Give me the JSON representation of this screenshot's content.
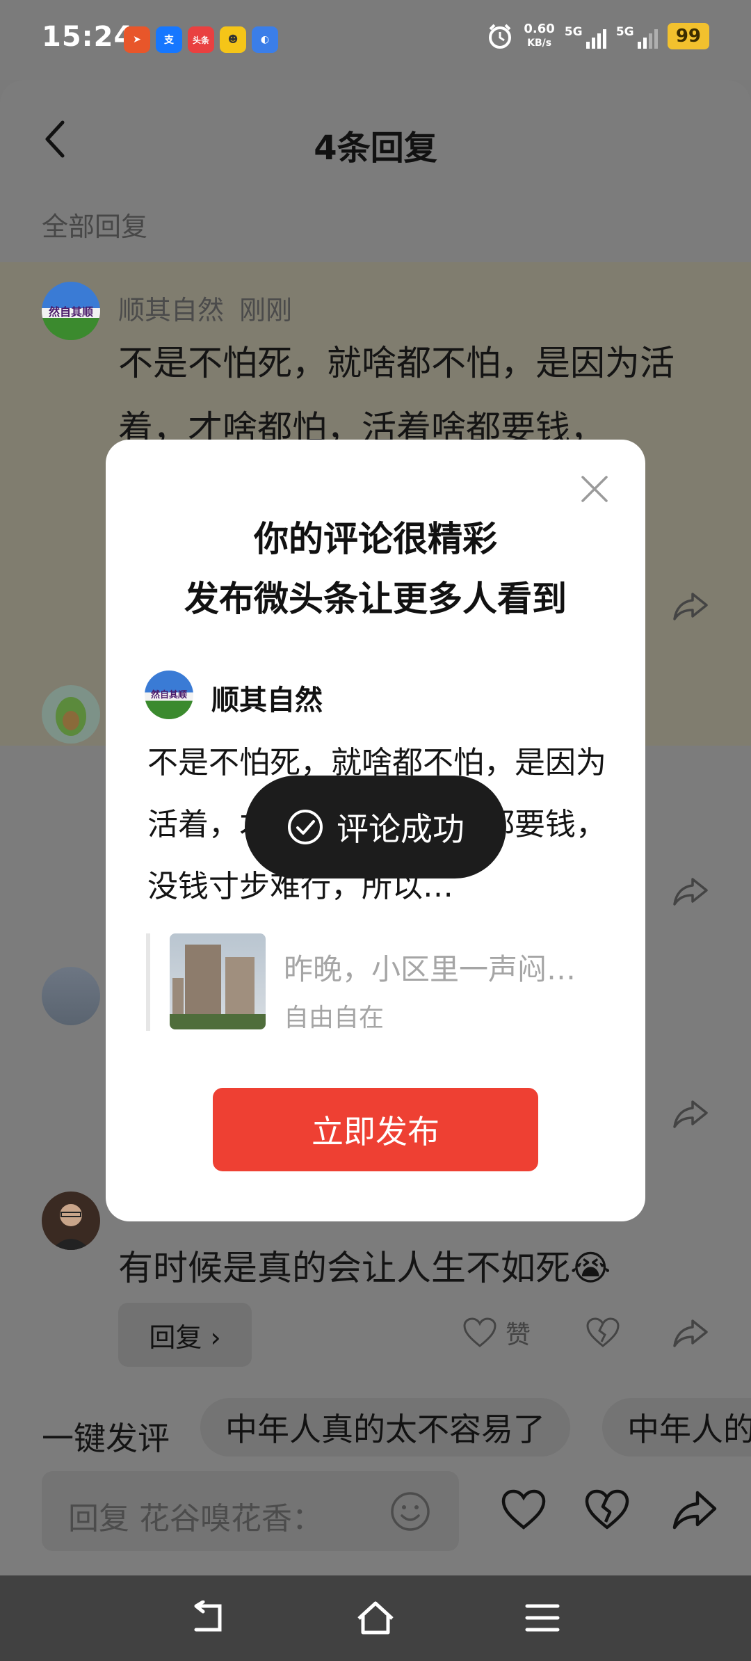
{
  "status_bar": {
    "time": "15:24",
    "apps": [
      {
        "name": "app-icon",
        "label": "",
        "color": "#e8562a"
      },
      {
        "name": "alipay-icon",
        "label": "支",
        "color": "#1677ff"
      },
      {
        "name": "toutiao-icon",
        "label": "头条",
        "color": "#e94040"
      },
      {
        "name": "app-icon",
        "label": "",
        "color": "#f5c518"
      },
      {
        "name": "app-icon",
        "label": "",
        "color": "#3b7ee8"
      }
    ],
    "net_speed_value": "0.60",
    "net_speed_unit": "KB/s",
    "signal1_label": "5G",
    "signal2_label": "5G",
    "battery": "99",
    "battery_color": "#f2c12e"
  },
  "header": {
    "title": "4条回复",
    "section_label": "全部回复"
  },
  "comments": [
    {
      "author": "顺其自然",
      "time": "刚刚",
      "avatar_text": "然自其顺",
      "text": "不是不怕死，就啥都不怕，是因为活着，才啥都怕，活着啥都要钱，"
    },
    {
      "meta": "",
      "text": "有时候是真的会让人生不如死😭",
      "reply_label": "回复 ›",
      "like_label": "赞"
    }
  ],
  "quick_comments": {
    "label": "一键发评",
    "chips": [
      "中年人真的太不容易了",
      "中年人的"
    ]
  },
  "input": {
    "placeholder": "回复 花谷嗅花香："
  },
  "modal": {
    "title_line1": "你的评论很精彩",
    "title_line2": "发布微头条让更多人看到",
    "author": "顺其自然",
    "avatar_text": "然自其顺",
    "text": "不是不怕死，就啥都不怕，是因为活着，才啥都怕，活着啥都要钱，没钱寸步难行，所以…",
    "quote_title": "昨晚，小区里一声闷…",
    "quote_author": "自由自在",
    "publish_label": "立即发布"
  },
  "toast": {
    "text": "评论成功"
  },
  "colors": {
    "accent": "#ee4033",
    "overlay_bg": "#7c7c7c",
    "highlight_comment_bg": "#807d6f"
  }
}
